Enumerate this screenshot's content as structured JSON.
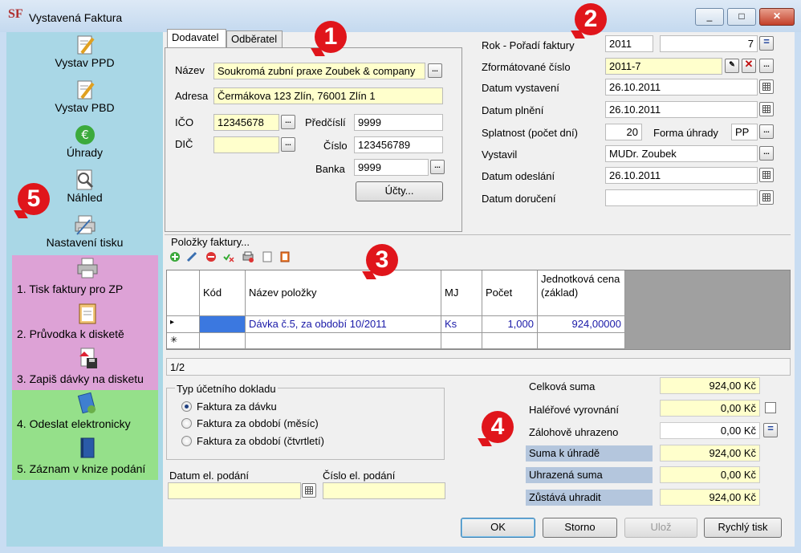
{
  "window": {
    "title": "Vystavená Faktura",
    "app_icon": "SF",
    "btn_minimize": "_",
    "btn_maximize": "□",
    "btn_close": "✕"
  },
  "sidebar": {
    "items": [
      {
        "label": "Vystav PPD",
        "icon": "document-pencil-icon"
      },
      {
        "label": "Vystav PBD",
        "icon": "document-pencil-icon"
      },
      {
        "label": "Úhrady",
        "icon": "euro-icon"
      },
      {
        "label": "Náhled",
        "icon": "magnifier-document-icon"
      },
      {
        "label": "Nastavení tisku",
        "icon": "printer-settings-icon"
      },
      {
        "label": "1. Tisk faktury pro ZP",
        "icon": "printer-icon"
      },
      {
        "label": "2. Průvodka k disketě",
        "icon": "clipboard-icon"
      },
      {
        "label": "3. Zapiš dávky na disketu",
        "icon": "disk-write-icon"
      },
      {
        "label": "4. Odeslat elektronicky",
        "icon": "send-icon"
      },
      {
        "label": "5. Záznam v knize podání",
        "icon": "book-icon"
      }
    ]
  },
  "tabs": [
    {
      "label": "Dodavatel"
    },
    {
      "label": "Odběratel"
    }
  ],
  "supplier": {
    "name_label": "Název",
    "name_value": "Soukromá zubní praxe Zoubek & company",
    "address_label": "Adresa",
    "address_value": "Čermákova 123 Zlín, 76001 Zlín 1",
    "ico_label": "IČO",
    "ico_value": "12345678",
    "dic_label": "DIČ",
    "dic_value": "",
    "prefix_label": "Předčíslí",
    "prefix_value": "9999",
    "number_label": "Číslo",
    "number_value": "123456789",
    "bank_label": "Banka",
    "bank_value": "9999",
    "accounts_button": "Účty..."
  },
  "invoice": {
    "year_label": "Rok - Pořadí faktury",
    "year_value": "2011",
    "order_value": "7",
    "order_button": "=",
    "formatted_label": "Zformátované číslo",
    "formatted_value": "2011-7",
    "issued_label": "Datum vystavení",
    "issued_value": "26.10.2011",
    "fulfilled_label": "Datum plnění",
    "fulfilled_value": "26.10.2011",
    "due_label": "Splatnost (počet dní)",
    "due_value": "20",
    "payment_label": "Forma úhrady",
    "payment_value": "PP",
    "issuer_label": "Vystavil",
    "issuer_value": "MUDr. Zoubek",
    "sent_label": "Datum odeslání",
    "sent_value": "26.10.2011",
    "delivered_label": "Datum doručení",
    "delivered_value": ""
  },
  "items_section": {
    "title": "Položky faktury...",
    "toolbar": [
      "add-icon",
      "edit-icon",
      "delete-icon",
      "check-icon",
      "print-icon",
      "document-icon",
      "copy-icon"
    ]
  },
  "grid": {
    "columns": [
      "Kód",
      "Název položky",
      "MJ",
      "Počet",
      "Jednotková cena (základ)"
    ],
    "rows": [
      {
        "marker": "▸",
        "code": "",
        "name": "Dávka č.5, za období 10/2011",
        "unit": "Ks",
        "count": "1,000",
        "price": "924,00000"
      }
    ],
    "new_row_marker": "✳"
  },
  "pager": "1/2",
  "doc_type": {
    "title": "Typ účetního dokladu",
    "options": [
      "Faktura za dávku",
      "Faktura za období (měsíc)",
      "Faktura za období (čtvrtletí)"
    ],
    "selected": 0
  },
  "el_submission": {
    "date_label": "Datum el. podání",
    "date_value": "",
    "number_label": "Číslo el. podání",
    "number_value": ""
  },
  "sums": {
    "total_label": "Celková suma",
    "total_value": "924,00 Kč",
    "rounding_label": "Haléřové vyrovnání",
    "rounding_value": "0,00 Kč",
    "advance_label": "Zálohově uhrazeno",
    "advance_value": "0,00 Kč",
    "to_pay_label": "Suma k úhradě",
    "to_pay_value": "924,00 Kč",
    "paid_label": "Uhrazená suma",
    "paid_value": "0,00 Kč",
    "remaining_label": "Zůstává uhradit",
    "remaining_value": "924,00 Kč"
  },
  "buttons": {
    "ok": "OK",
    "cancel": "Storno",
    "save": "Ulož",
    "quick_print": "Rychlý tisk"
  },
  "badges": [
    "1",
    "2",
    "3",
    "4",
    "5"
  ],
  "colors": {
    "badge": "#e0151b",
    "sidebar": "#a9d7e6",
    "pink": "#dda2d6",
    "green": "#95e08a",
    "yellow_field": "#ffffcc",
    "sum_label_blue": "#b4c6dd",
    "link_text": "#1a1aa8"
  }
}
